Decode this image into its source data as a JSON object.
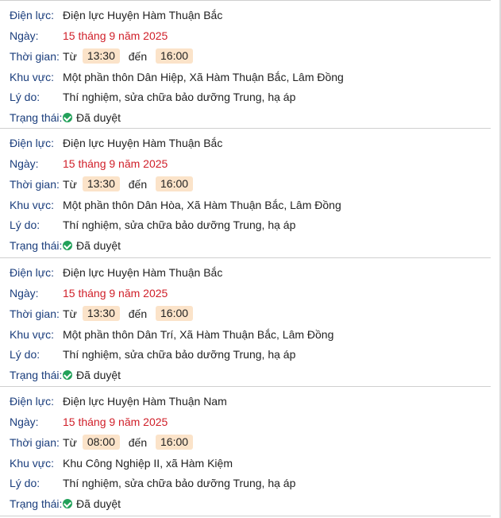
{
  "labels": {
    "company": "Điện lực:",
    "date": "Ngày:",
    "time": "Thời gian:",
    "area": "Khu vực:",
    "reason": "Lý do:",
    "status": "Trạng thái:",
    "from": "Từ",
    "to": "đến"
  },
  "entries": [
    {
      "company": "Điện lực Huyện Hàm Thuận Bắc",
      "date": "15 tháng 9 năm 2025",
      "start": "13:30",
      "end": "16:00",
      "area": "Một phần thôn Dân Hiệp, Xã Hàm Thuận Bắc, Lâm Đồng",
      "reason": "Thí nghiệm, sửa chữa bảo dưỡng Trung, hạ áp",
      "status": "Đã duyệt"
    },
    {
      "company": "Điện lực Huyện Hàm Thuận Bắc",
      "date": "15 tháng 9 năm 2025",
      "start": "13:30",
      "end": "16:00",
      "area": "Một phần thôn Dân Hòa, Xã Hàm Thuận Bắc, Lâm Đồng",
      "reason": "Thí nghiệm, sửa chữa bảo dưỡng Trung, hạ áp",
      "status": "Đã duyệt"
    },
    {
      "company": "Điện lực Huyện Hàm Thuận Bắc",
      "date": "15 tháng 9 năm 2025",
      "start": "13:30",
      "end": "16:00",
      "area": "Một phần thôn Dân Trí, Xã Hàm Thuận Bắc, Lâm Đồng",
      "reason": "Thí nghiệm, sửa chữa bảo dưỡng Trung, hạ áp",
      "status": "Đã duyệt"
    },
    {
      "company": "Điện lực Huyện Hàm Thuận Nam",
      "date": "15 tháng 9 năm 2025",
      "start": "08:00",
      "end": "16:00",
      "area": "Khu Công Nghiệp II, xã Hàm Kiệm",
      "reason": "Thí nghiệm, sửa chữa bảo dưỡng Trung, hạ áp",
      "status": "Đã duyệt"
    }
  ],
  "colors": {
    "label": "#1a3d7c",
    "date": "#d0202a",
    "time_chip": "#fbe3c9",
    "status_check": "#22a15a"
  },
  "icons": {
    "status": "check-circle-icon"
  }
}
